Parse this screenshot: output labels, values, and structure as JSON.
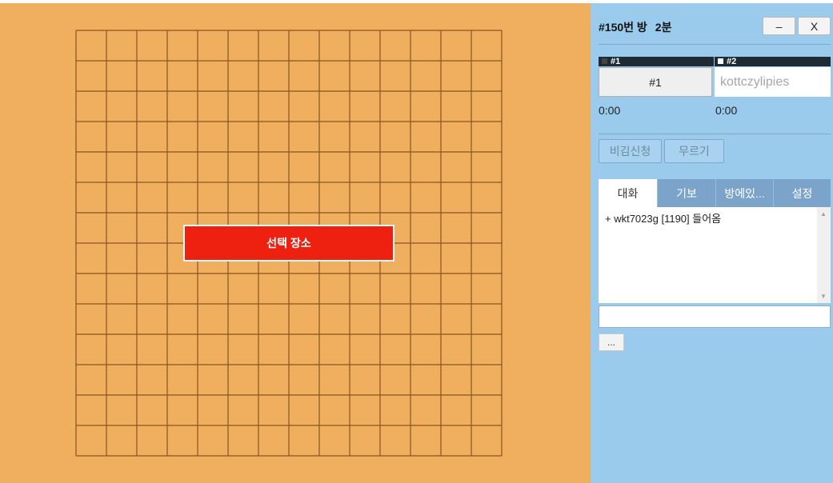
{
  "board": {
    "overlay_label": "선택 장소",
    "colors": {
      "wood": "#f0ae5f",
      "line": "#8a5422",
      "overlay": "#ee2111"
    }
  },
  "panel": {
    "room": "#150번 방",
    "time_limit": "2분",
    "minimize_label": "–",
    "close_label": "X"
  },
  "players": [
    {
      "tag": "#1",
      "stone": "black",
      "name": "#1",
      "time": "0:00"
    },
    {
      "tag": "#2",
      "stone": "white",
      "name": "kottczylipies",
      "time": "0:00"
    }
  ],
  "actions": {
    "draw_label": "비김신청",
    "undo_label": "무르기"
  },
  "tabs": [
    {
      "label": "대화",
      "active": true
    },
    {
      "label": "기보",
      "active": false
    },
    {
      "label": "방에있...",
      "active": false
    },
    {
      "label": "설정",
      "active": false
    }
  ],
  "chat": {
    "messages": [
      "+ wkt7023g [1190] 들어옴"
    ],
    "input_value": "",
    "more_label": "..."
  }
}
